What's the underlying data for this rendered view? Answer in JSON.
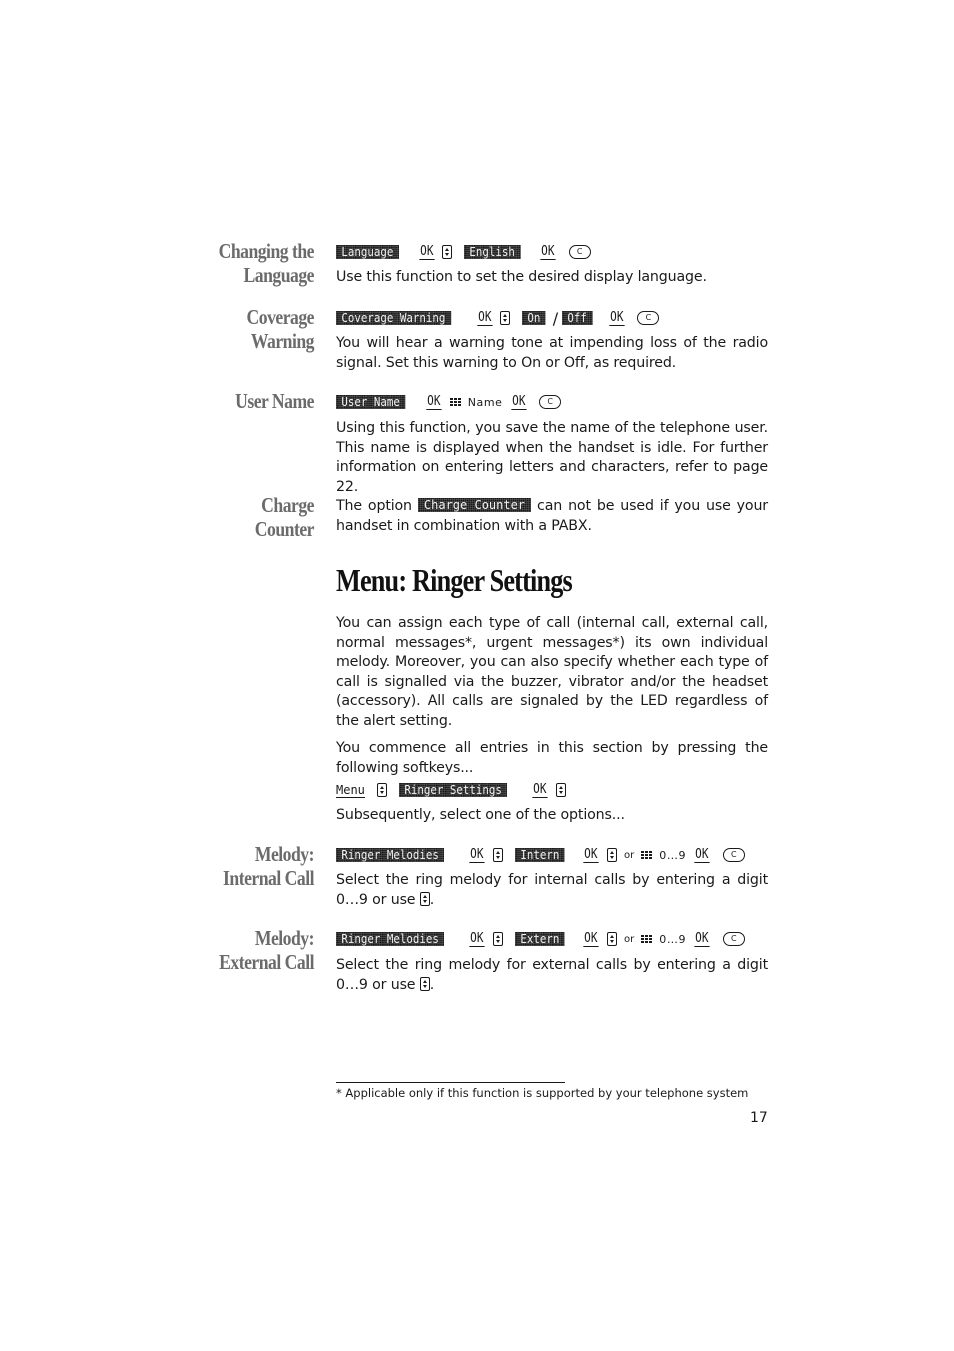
{
  "sections": {
    "changing_language": {
      "heading": [
        "Changing the",
        "Language"
      ],
      "sequence": {
        "display1": "Language",
        "ok": "OK",
        "display2": "English",
        "ok2": "OK",
        "clear": "C"
      },
      "text": "Use this function to set the desired display language."
    },
    "coverage_warning": {
      "heading": [
        "Coverage",
        "Warning"
      ],
      "sequence": {
        "display1": "Coverage Warning",
        "ok": "OK",
        "on": "On",
        "separator": "/",
        "off": "Off",
        "ok2": "OK",
        "clear": "C"
      },
      "text": "You will hear a warning tone at impending loss of the radio signal. Set this warning to On or Off, as required."
    },
    "user_name": {
      "heading": [
        "User Name"
      ],
      "sequence": {
        "display1": "User Name",
        "ok": "OK",
        "input_label": "Name",
        "ok2": "OK",
        "clear": "C"
      },
      "text": "Using this function, you save the name of the telephone user. This name is displayed when the handset is idle. For further information on entering letters and characters, refer to page 22."
    },
    "charge_counter": {
      "heading": [
        "Charge",
        "Counter"
      ],
      "text_before": "The option",
      "display": "Charge Counter",
      "text_after": "can not be used if you use your handset in combination with a PABX."
    },
    "ringer": {
      "title": "Menu: Ringer Settings",
      "intro": "You can assign each type of call (internal call, external call, normal messages*, urgent messages*) its own individual melody. Moreover, you can also specify whether each type of call is signalled via the buzzer, vibrator and/or the headset (accessory). All calls are signaled by the LED regardless of the alert setting.",
      "commence": "You commence all entries in this section by pressing the following softkeys...",
      "sequence": {
        "menu": "Menu",
        "display1": "Ringer Settings",
        "ok": "OK"
      },
      "subsequently": "Subsequently, select one of the options..."
    },
    "melody_internal": {
      "heading": [
        "Melody:",
        "Internal Call"
      ],
      "sequence": {
        "display1": "Ringer Melodies",
        "ok": "OK",
        "display2": "Intern",
        "ok2": "OK",
        "or": "or",
        "range": "0…9",
        "ok3": "OK",
        "clear": "C"
      },
      "text": "Select the ring melody for internal calls by entering a digit 0…9 or use",
      "text_end": "."
    },
    "melody_external": {
      "heading": [
        "Melody:",
        "External Call"
      ],
      "sequence": {
        "display1": "Ringer Melodies",
        "ok": "OK",
        "display2": "Extern",
        "ok2": "OK",
        "or": "or",
        "range": "0…9",
        "ok3": "OK",
        "clear": "C"
      },
      "text": "Select the ring melody for external calls by entering a digit 0…9 or use",
      "text_end": "."
    }
  },
  "footnote": "*  Applicable only if this function is supported by your telephone system",
  "page_number": "17",
  "icons": {
    "scroll": "up-down-arrow-icon",
    "clear": "c-key-icon",
    "keypad": "keypad-icon"
  }
}
